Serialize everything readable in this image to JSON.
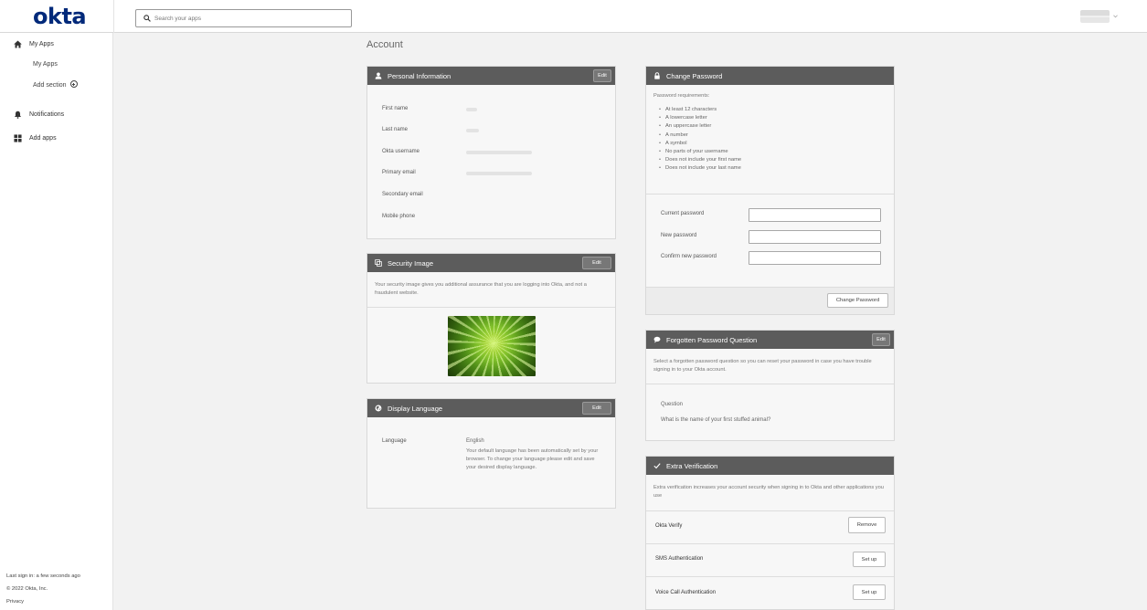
{
  "header": {
    "logo": "okta",
    "search_placeholder": "Search your apps"
  },
  "sidebar": {
    "my_apps": "My Apps",
    "sub_my_apps": "My Apps",
    "add_section": "Add section",
    "notifications": "Notifications",
    "add_apps": "Add apps",
    "footer": {
      "last_sign_in": "Last sign in: a few seconds ago",
      "copyright": "© 2022 Okta, Inc.",
      "privacy": "Privacy"
    }
  },
  "page": {
    "title": "Account"
  },
  "personal": {
    "title": "Personal Information",
    "edit": "Edit",
    "labels": {
      "first_name": "First name",
      "last_name": "Last name",
      "username": "Okta username",
      "primary_email": "Primary email",
      "secondary_email": "Secondary email",
      "mobile_phone": "Mobile phone"
    }
  },
  "security_image": {
    "title": "Security Image",
    "edit": "Edit",
    "description": "Your security image gives you additional assurance that you are logging into Okta, and not a fraudulent website."
  },
  "display_language": {
    "title": "Display Language",
    "edit": "Edit",
    "label": "Language",
    "value": "English",
    "description": "Your default language has been automatically set by your browser. To change your language please edit and save your desired display language."
  },
  "change_password": {
    "title": "Change Password",
    "requirements_heading": "Password requirements:",
    "requirements": [
      "At least 12 characters",
      "A lowercase letter",
      "An uppercase letter",
      "A number",
      "A symbol",
      "No parts of your username",
      "Does not include your first name",
      "Does not include your last name"
    ],
    "current_label": "Current password",
    "new_label": "New password",
    "confirm_label": "Confirm new password",
    "submit": "Change Password"
  },
  "forgotten_question": {
    "title": "Forgotten Password Question",
    "edit": "Edit",
    "description": "Select a forgotten password question so you can reset your password in case you have trouble signing in to your Okta account.",
    "question_label": "Question",
    "question_value": "What is the name of your first stuffed animal?"
  },
  "extra_verification": {
    "title": "Extra Verification",
    "description": "Extra verification increases your account security when signing in to Okta and other applications you use",
    "factors": [
      {
        "name": "Okta Verify",
        "action": "Remove"
      },
      {
        "name": "SMS Authentication",
        "action": "Set up"
      },
      {
        "name": "Voice Call Authentication",
        "action": "Set up"
      }
    ]
  },
  "colors": {
    "brand": "#00297a",
    "card_header": "#5c5c5c",
    "background": "#f2f2f2"
  }
}
